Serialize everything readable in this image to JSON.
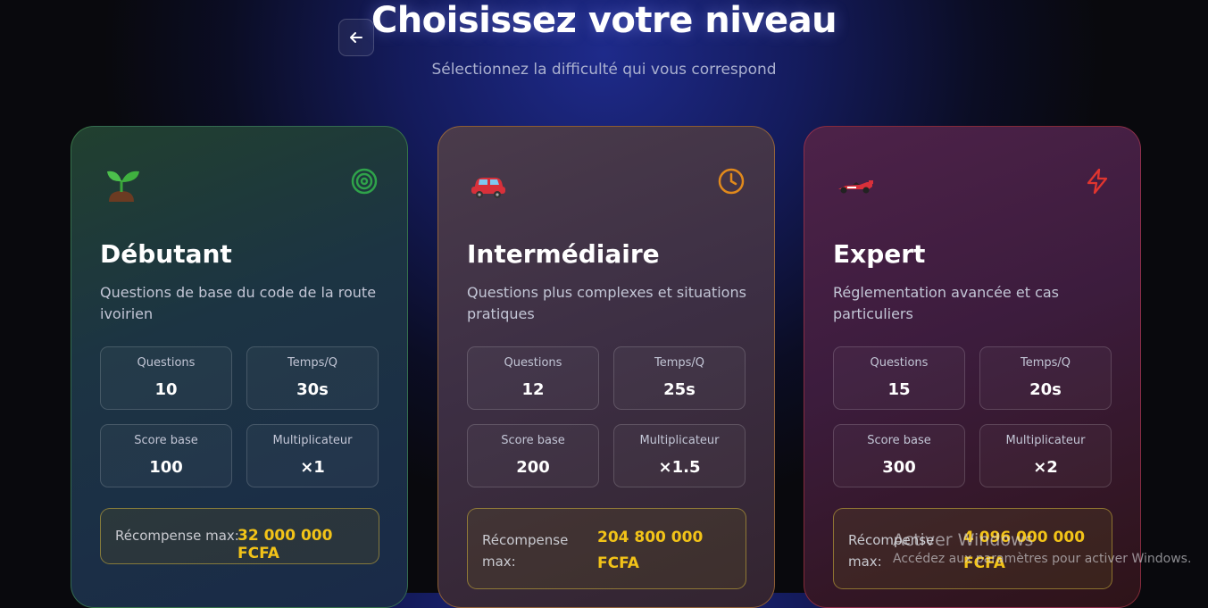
{
  "header": {
    "title": "Choisissez votre niveau",
    "subtitle": "Sélectionnez la difficulté qui vous correspond",
    "back_icon": "arrow-left-icon"
  },
  "levels": [
    {
      "name": "Débutant",
      "description": "Questions de base du code de la route ivoirien",
      "emoji": "seedling",
      "icon": "target-icon",
      "accent": "#2fa24a",
      "stats": [
        {
          "label": "Questions",
          "value": "10"
        },
        {
          "label": "Temps/Q",
          "value": "30s"
        },
        {
          "label": "Score base",
          "value": "100"
        },
        {
          "label": "Multiplicateur",
          "value": "×1"
        }
      ],
      "reward_label": "Récompense max:",
      "reward_value": "32 000 000 FCFA"
    },
    {
      "name": "Intermédiaire",
      "description": "Questions plus complexes et situations pratiques",
      "emoji": "car",
      "icon": "clock-icon",
      "accent": "#e0891c",
      "stats": [
        {
          "label": "Questions",
          "value": "12"
        },
        {
          "label": "Temps/Q",
          "value": "25s"
        },
        {
          "label": "Score base",
          "value": "200"
        },
        {
          "label": "Multiplicateur",
          "value": "×1.5"
        }
      ],
      "reward_label": "Récompense max:",
      "reward_value": "204 800 000 FCFA"
    },
    {
      "name": "Expert",
      "description": "Réglementation avancée et cas particuliers",
      "emoji": "racing-car",
      "icon": "lightning-icon",
      "accent": "#e0352f",
      "stats": [
        {
          "label": "Questions",
          "value": "15"
        },
        {
          "label": "Temps/Q",
          "value": "20s"
        },
        {
          "label": "Score base",
          "value": "300"
        },
        {
          "label": "Multiplicateur",
          "value": "×2"
        }
      ],
      "reward_label": "Récompense max:",
      "reward_value": "4 096 000 000 FCFA"
    }
  ],
  "watermark": {
    "line1": "Activer Windows",
    "line2": "Accédez aux paramètres pour activer Windows."
  },
  "colors": {
    "reward_text": "#f2c318",
    "background_glow": "#1e2a8a"
  }
}
